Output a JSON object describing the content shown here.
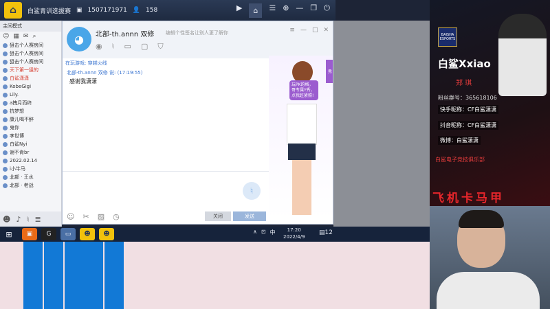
{
  "topbar": {
    "title": "白鲨青训选拔赛",
    "id": "1507171971",
    "viewers": "158"
  },
  "left_panel": {
    "header": "主间模式",
    "items": [
      {
        "label": "狙击个人赛房间",
        "highlight": false
      },
      {
        "label": "狙击个人赛房间",
        "highlight": false
      },
      {
        "label": "狙击个人赛房间",
        "highlight": false
      },
      {
        "label": "天下第一狙的",
        "highlight": true
      },
      {
        "label": "白鲨潇潇",
        "highlight": true
      },
      {
        "label": "KobeGigi",
        "highlight": false
      },
      {
        "label": "Lily.",
        "highlight": false
      },
      {
        "label": "a拽月而终",
        "highlight": false
      },
      {
        "label": "抗梦想",
        "highlight": false
      },
      {
        "label": "康儿喝不醉",
        "highlight": false
      },
      {
        "label": "鬼你",
        "highlight": false
      },
      {
        "label": "李世博",
        "highlight": false
      },
      {
        "label": "白鲨Nyi",
        "highlight": false
      },
      {
        "label": "谢不肯br",
        "highlight": false
      },
      {
        "label": "2022.02.14",
        "highlight": false
      },
      {
        "label": "i小牛马",
        "highlight": false
      },
      {
        "label": "北部 · 王水",
        "highlight": false
      },
      {
        "label": "北部 · 老战",
        "highlight": false
      }
    ]
  },
  "chat": {
    "contact_name": "北部-th.annn 双修",
    "status_text": "编辑个性签名让别人更了解你",
    "game_status": "在玩游戏: 穿越火线",
    "message_meta": "北部-th.annn 双修 说: (17:19:55)",
    "message_body": "感谢我潇潇",
    "showcase_bubble": "玩PK的格，哥专属Y秀，点我赶紧照!",
    "showcase_tab": "秀",
    "close_label": "关闭",
    "send_label": "发送"
  },
  "taskbar": {
    "tray_lang": "中",
    "time": "17:20",
    "date": "2022/4/9",
    "notifications": "12"
  },
  "stream_overlay": {
    "team_logo_text": "BAISHA ESPORTS",
    "title": "白鲨Xxiao",
    "real_name": "郑 琪",
    "fans_group": "粉丝群号：365618106",
    "kuaishou": "快手昵称：CF白鲨潇潇",
    "douyin": "抖音昵称：CF白鲨潇潇",
    "weibo": "微博：白鲨潇潇",
    "club": "白鲨电子竞技俱乐部",
    "ad_text": "飞机卡马甲"
  },
  "colors": {
    "accent_blue": "#1279d6",
    "overlay_red": "#e03b3b",
    "topbar_bg": "#2b3a55"
  }
}
